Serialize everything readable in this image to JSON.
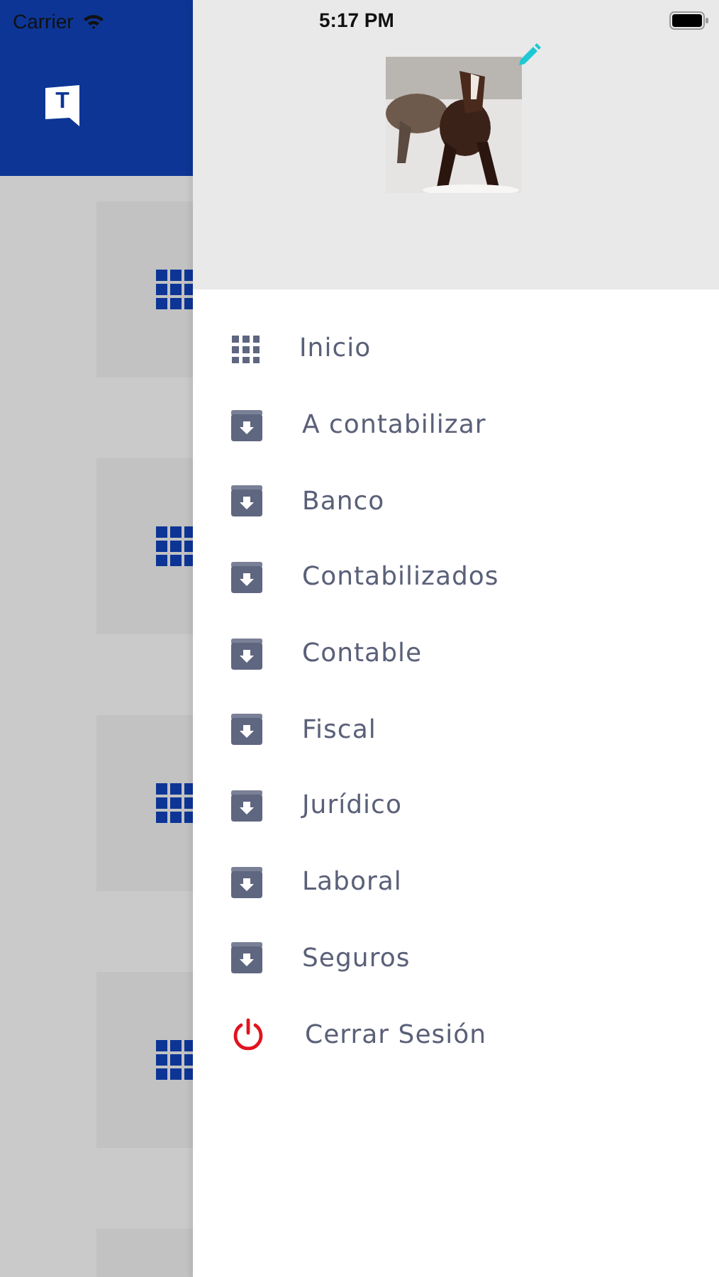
{
  "status_bar": {
    "carrier": "Carrier",
    "time": "5:17 PM"
  },
  "app_header": {
    "logo": "T"
  },
  "background_cards": [
    {
      "kind": "grid"
    },
    {
      "kind": "grid"
    },
    {
      "kind": "grid"
    },
    {
      "kind": "grid"
    },
    {
      "kind": "plain"
    }
  ],
  "drawer": {
    "menu": [
      {
        "label": "Inicio",
        "kind": "home"
      },
      {
        "label": "A contabilizar",
        "kind": "folder"
      },
      {
        "label": "Banco",
        "kind": "folder"
      },
      {
        "label": "Contabilizados",
        "kind": "folder"
      },
      {
        "label": "Contable",
        "kind": "folder"
      },
      {
        "label": "Fiscal",
        "kind": "folder"
      },
      {
        "label": "Jurídico",
        "kind": "folder"
      },
      {
        "label": "Laboral",
        "kind": "folder"
      },
      {
        "label": "Seguros",
        "kind": "folder"
      },
      {
        "label": "Cerrar Sesión",
        "kind": "logout"
      }
    ]
  }
}
